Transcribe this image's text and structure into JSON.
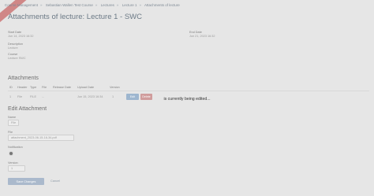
{
  "breadcrumb": [
    "Course Management",
    "Sebastian Wallen Test Course",
    "Lectures",
    "Lecture 1",
    "Attachments of lecture"
  ],
  "page_title": "Attachments of lecture: Lecture 1 - SWC",
  "meta": {
    "start_date_label": "Start Date",
    "start_date_value": "Jun 14, 2023 16:32",
    "end_date_label": "End Date",
    "end_date_value": "Jun 21, 2023 16:32",
    "description_label": "Description",
    "description_value": "Lecture",
    "course_label": "Course",
    "course_value": "Lecture SWC"
  },
  "attachments": {
    "heading": "Attachments",
    "columns": [
      "ID",
      "Header",
      "Type",
      "File",
      "Release Date",
      "Upload Date",
      "Version"
    ],
    "row": {
      "id": "1",
      "header": "File",
      "type": "FILE",
      "file": "...",
      "release_date": "",
      "upload_date": "Jun 15, 2023 16:34",
      "version": "1"
    },
    "edit_button": "Edit",
    "delete_button": "Delete"
  },
  "edit_form": {
    "heading": "Edit Attachment",
    "name_label": "Name",
    "name_value": "File",
    "file_label": "File",
    "file_value": "attachment_2023-06-15-16-34.pdf",
    "release_label": "Release date",
    "release_value": "",
    "notification_label": "Notification",
    "version_label": "Version",
    "version_value": "1",
    "save_button": "Save Changes",
    "cancel_link": "Cancel"
  },
  "overlay_message": "is currently being edited..."
}
